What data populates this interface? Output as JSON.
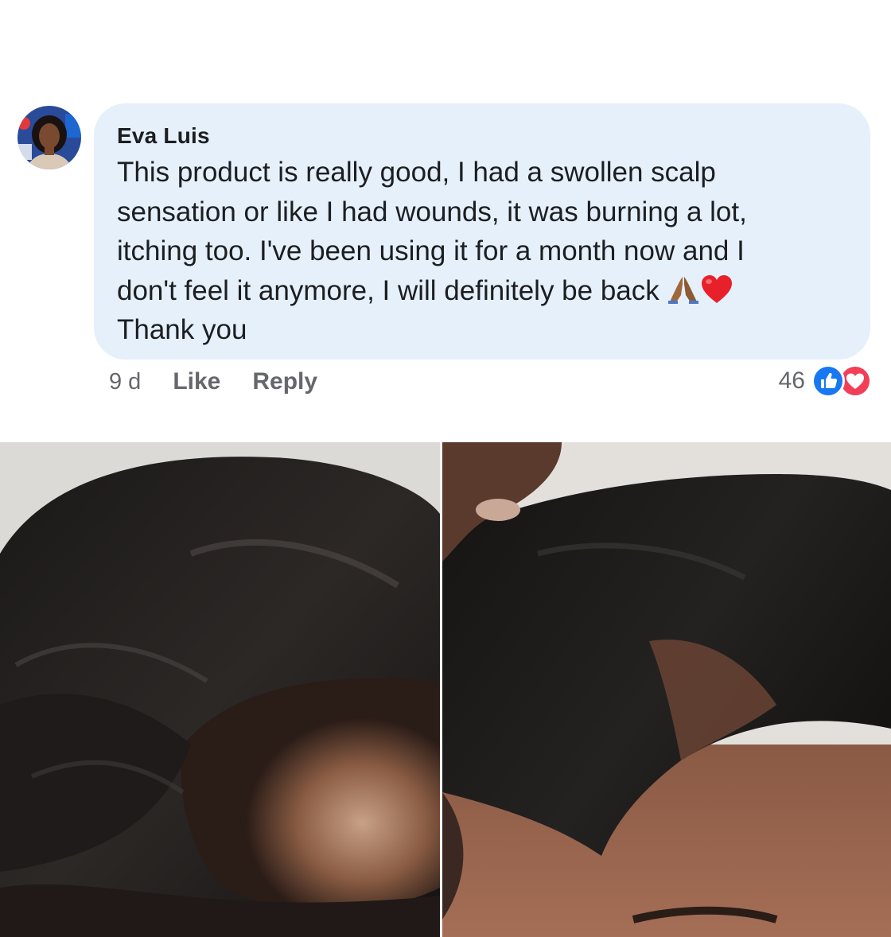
{
  "comment": {
    "author": "Eva Luis",
    "text": "This product is really good, I had a swollen scalp\nsensation or like I had wounds, it was burning a lot,\nitching too. I've been using it for a month now and I\ndon't feel it anymore, I will definitely be back ",
    "text_end": "Thank you",
    "emojis": [
      "folded-hands-icon",
      "red-heart-icon"
    ],
    "bubble_color": "#e5f0fb"
  },
  "actions": {
    "timestamp": "9 d",
    "like_label": "Like",
    "reply_label": "Reply"
  },
  "reactions": {
    "count": "46",
    "icons": [
      "like-icon",
      "love-icon"
    ],
    "like_color": "#1877f2",
    "love_color": "#f33e58"
  },
  "photos": {
    "left": "before-scalp-photo",
    "right": "after-scalp-photo"
  }
}
